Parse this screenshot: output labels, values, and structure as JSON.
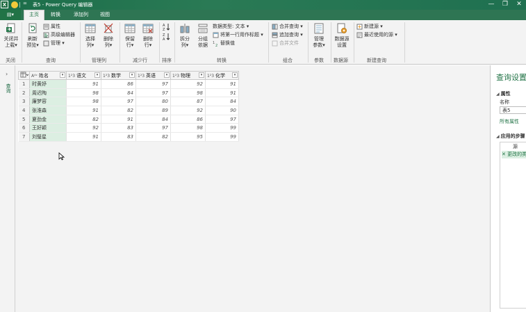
{
  "titlebar": {
    "app_logo": "X",
    "qat_dropdown": "=",
    "title": "表5 - Power Query 编辑器",
    "controls": [
      "—",
      "❐",
      "✕"
    ]
  },
  "tabs": {
    "file": "文件",
    "items": [
      "主页",
      "转换",
      "添加列",
      "视图"
    ],
    "active": "主页"
  },
  "ribbon": {
    "groups": {
      "close": "关闭",
      "query": "查询",
      "manage_cols": "管理列",
      "reduce_rows": "减少行",
      "sort": "排序",
      "transform": "转换",
      "combine": "组合",
      "params": "参数",
      "datasource": "数据源",
      "newquery": "新建查询"
    },
    "close_load": [
      "关闭并",
      "上载▾"
    ],
    "refresh_preview": [
      "刷新",
      "预览▾"
    ],
    "properties": "属性",
    "advanced_editor": "高级编辑器",
    "manage": "管理 ▾",
    "choose_cols": [
      "选择",
      "列▾"
    ],
    "remove_cols": [
      "删除",
      "列▾"
    ],
    "keep_rows": [
      "保留",
      "行▾"
    ],
    "remove_rows": [
      "删除",
      "行▾"
    ],
    "split_col": [
      "拆分",
      "列▾"
    ],
    "group_by": [
      "分组",
      "依据"
    ],
    "data_type": "数据类型: 文本 ▾",
    "first_row_header": "将第一行用作标题 ▾",
    "replace_values": "替换值",
    "merge_queries": "合并查询 ▾",
    "append_queries": "追加查询 ▾",
    "combine_files": "合并文件",
    "manage_params": [
      "管理",
      "参数▾"
    ],
    "datasource_settings": [
      "数据源",
      "设置"
    ],
    "new_source": "新建源 ▾",
    "recent_sources": "最近使用的源 ▾"
  },
  "left_strip": {
    "expand": "›",
    "label": "查询"
  },
  "grid": {
    "columns": [
      {
        "type": "Aᴬᶜ",
        "name": "姓名"
      },
      {
        "type": "1²3",
        "name": "语文"
      },
      {
        "type": "1²3",
        "name": "数学"
      },
      {
        "type": "1²3",
        "name": "英语"
      },
      {
        "type": "1²3",
        "name": "物理"
      },
      {
        "type": "1²3",
        "name": "化学"
      }
    ],
    "rows": [
      [
        "1",
        "时黄妤",
        "91",
        "86",
        "97",
        "92",
        "91"
      ],
      [
        "2",
        "周迟陶",
        "98",
        "84",
        "97",
        "98",
        "91"
      ],
      [
        "3",
        "廉梦容",
        "98",
        "97",
        "80",
        "87",
        "84"
      ],
      [
        "4",
        "张淮森",
        "91",
        "82",
        "89",
        "92",
        "90"
      ],
      [
        "5",
        "夏劲金",
        "82",
        "91",
        "84",
        "86",
        "97"
      ],
      [
        "6",
        "王好颖",
        "92",
        "83",
        "97",
        "98",
        "99"
      ],
      [
        "7",
        "刘璧星",
        "91",
        "83",
        "82",
        "95",
        "99"
      ]
    ]
  },
  "settings": {
    "title": "查询设置",
    "properties_head": "属性",
    "name_label": "名称",
    "name_value": "表5",
    "all_props": "所有属性",
    "steps_head": "应用的步骤",
    "steps": [
      "源",
      "更改的类型"
    ]
  }
}
